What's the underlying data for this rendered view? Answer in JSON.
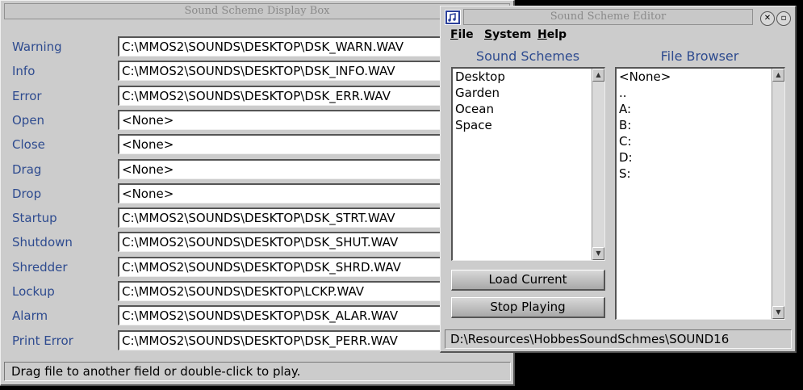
{
  "display_box": {
    "title": "Sound Scheme Display Box",
    "rows": [
      {
        "label": "Warning",
        "value": "C:\\MMOS2\\SOUNDS\\DESKTOP\\DSK_WARN.WAV"
      },
      {
        "label": "Info",
        "value": "C:\\MMOS2\\SOUNDS\\DESKTOP\\DSK_INFO.WAV"
      },
      {
        "label": "Error",
        "value": "C:\\MMOS2\\SOUNDS\\DESKTOP\\DSK_ERR.WAV"
      },
      {
        "label": "Open",
        "value": "<None>"
      },
      {
        "label": "Close",
        "value": "<None>"
      },
      {
        "label": "Drag",
        "value": "<None>"
      },
      {
        "label": "Drop",
        "value": "<None>"
      },
      {
        "label": "Startup",
        "value": "C:\\MMOS2\\SOUNDS\\DESKTOP\\DSK_STRT.WAV"
      },
      {
        "label": "Shutdown",
        "value": "C:\\MMOS2\\SOUNDS\\DESKTOP\\DSK_SHUT.WAV"
      },
      {
        "label": "Shredder",
        "value": "C:\\MMOS2\\SOUNDS\\DESKTOP\\DSK_SHRD.WAV"
      },
      {
        "label": "Lockup",
        "value": "C:\\MMOS2\\SOUNDS\\DESKTOP\\LCKP.WAV"
      },
      {
        "label": "Alarm",
        "value": "C:\\MMOS2\\SOUNDS\\DESKTOP\\DSK_ALAR.WAV"
      },
      {
        "label": "Print Error",
        "value": "C:\\MMOS2\\SOUNDS\\DESKTOP\\DSK_PERR.WAV"
      }
    ],
    "status": "Drag file to another field or double-click to play."
  },
  "editor": {
    "title": "Sound Scheme Editor",
    "menu": [
      {
        "key": "F",
        "rest": "ile"
      },
      {
        "key": "S",
        "rest": "ystem"
      },
      {
        "key": "H",
        "rest": "elp"
      }
    ],
    "schemes_heading": "Sound Schemes",
    "schemes": [
      "Desktop",
      "Garden",
      "Ocean",
      "Space"
    ],
    "browser_heading": "File Browser",
    "files": [
      "<None>",
      "..",
      "A:",
      "B:",
      "C:",
      "D:",
      "S:"
    ],
    "load_button": "Load Current",
    "stop_button": "Stop Playing",
    "path": "D:\\Resources\\HobbesSoundSchmes\\SOUND16"
  }
}
